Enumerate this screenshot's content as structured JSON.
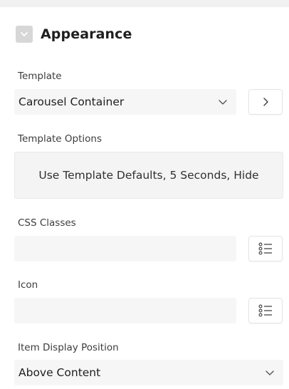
{
  "section": {
    "title": "Appearance"
  },
  "template": {
    "label": "Template",
    "value": "Carousel Container",
    "go_icon": "chevron-right-icon"
  },
  "template_options": {
    "label": "Template Options",
    "value": "Use Template Defaults, 5 Seconds, Hide"
  },
  "css_classes": {
    "label": "CSS Classes",
    "value": "",
    "list_icon": "list-picker-icon"
  },
  "icon_field": {
    "label": "Icon",
    "value": "",
    "list_icon": "list-picker-icon"
  },
  "item_display_position": {
    "label": "Item Display Position",
    "value": "Above Content"
  },
  "colors": {
    "field_background": "#f6f6f6",
    "toggle_background": "#d7d7d7",
    "text": "#262626"
  }
}
